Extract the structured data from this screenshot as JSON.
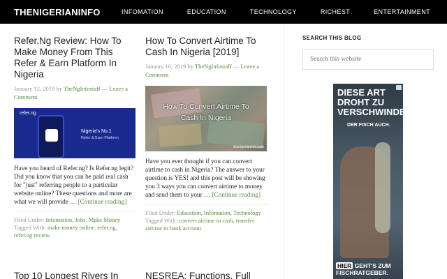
{
  "site": {
    "logo": "THENIGERIANINFO"
  },
  "nav": [
    {
      "label": "INFOMATION"
    },
    {
      "label": "EDUCATION"
    },
    {
      "label": "TECHNOLOGY"
    },
    {
      "label": "RICHEST"
    },
    {
      "label": "ENTERTAINMENT"
    }
  ],
  "posts": [
    {
      "title": "Refer.Ng Review: How To Make Money From This Refer & Earn Platform In Nigeria",
      "date": "January 12, 2019",
      "by": "by",
      "author": "TheNgInfostaff",
      "dash": "—",
      "comment": "Leave a Comment",
      "thumb_brand": "refer.ng",
      "thumb_tag1": "Nigeria's No.1",
      "thumb_tag2": "Refer & Earn Platform",
      "excerpt": "Have you heard of Refer.ng? Is Refer.ng legit? Did you know that you can be paid real cash for \"just\" referring people to a particular website online? These questions and more are what we will provide …",
      "more": "[Continue reading]",
      "filed_label": "Filed Under:",
      "filed": "Infomation, Jobs, Make Money",
      "tagged_label": "Tagged With:",
      "tagged": "make money online, refer.ng, refer.ng review"
    },
    {
      "title": "How To Convert Airtime To Cash In Nigeria [2019]",
      "date": "January 10, 2019",
      "by": "by",
      "author": "TheNgInfostaff",
      "dash": "—",
      "comment": "Leave a Comment",
      "thumb_cap1": "How To Convert Airtime To",
      "thumb_cap2": "Cash In Nigeria",
      "thumb_wm": "thenigerianinfo.com",
      "excerpt": "Have you ever thought if you can convert airtime to cash in Nigeria? The answer to your question is YES! and this post will be showing you 3 ways you can convert airtime to money and send them to your …",
      "more": "[Continue reading]",
      "filed_label": "Filed Under:",
      "filed": "Education, Infomation, Technology",
      "tagged_label": "Tagged With:",
      "tagged": "convert airtime to cash, transfer airtime to bank account"
    }
  ],
  "bottom_posts": [
    {
      "title": "Top 10 Longest Rivers In"
    },
    {
      "title": "NESREA: Functions, Full"
    }
  ],
  "sidebar": {
    "search_title": "SEARCH THIS BLOG",
    "search_placeholder": "Search this website",
    "ad": {
      "headline": "DIESE ART DROHT ZU VERSCHWINDEN.",
      "sub": "DER FISCH AUCH.",
      "footer_tag": "HIER",
      "footer_text": "GEHT'S ZUM FISCHRATGEBER."
    }
  },
  "colors": {
    "header_bg": "#000000",
    "link_green": "#5c8a3e",
    "ad_blue_bg": "#2f3b45"
  }
}
